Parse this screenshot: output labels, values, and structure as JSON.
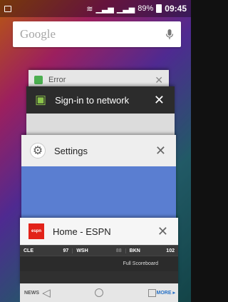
{
  "status_bar": {
    "battery_percent": "89%",
    "time": "09:45"
  },
  "search": {
    "logo": "Google",
    "mic_icon": "mic-icon"
  },
  "recents": {
    "cards": [
      {
        "title": "Error",
        "icon": "error-app-icon"
      },
      {
        "title": "Sign-in to network",
        "icon": "android-icon"
      },
      {
        "title": "Settings",
        "icon": "gear-icon"
      },
      {
        "title": "Home - ESPN",
        "icon": "espn-icon"
      }
    ],
    "espn_logo_text": "espn",
    "scores": [
      {
        "team": "CLE",
        "score": "97"
      },
      {
        "team": "WSH",
        "score": "88"
      },
      {
        "team": "BKN",
        "score": "102"
      }
    ],
    "full_scoreboard": "Full Scoreboard"
  },
  "nav_bar": {
    "left_label": "NEWS",
    "right_label": "MORE ▸",
    "back_icon": "back-icon",
    "home_icon": "home-icon",
    "recents_icon": "recents-icon"
  }
}
